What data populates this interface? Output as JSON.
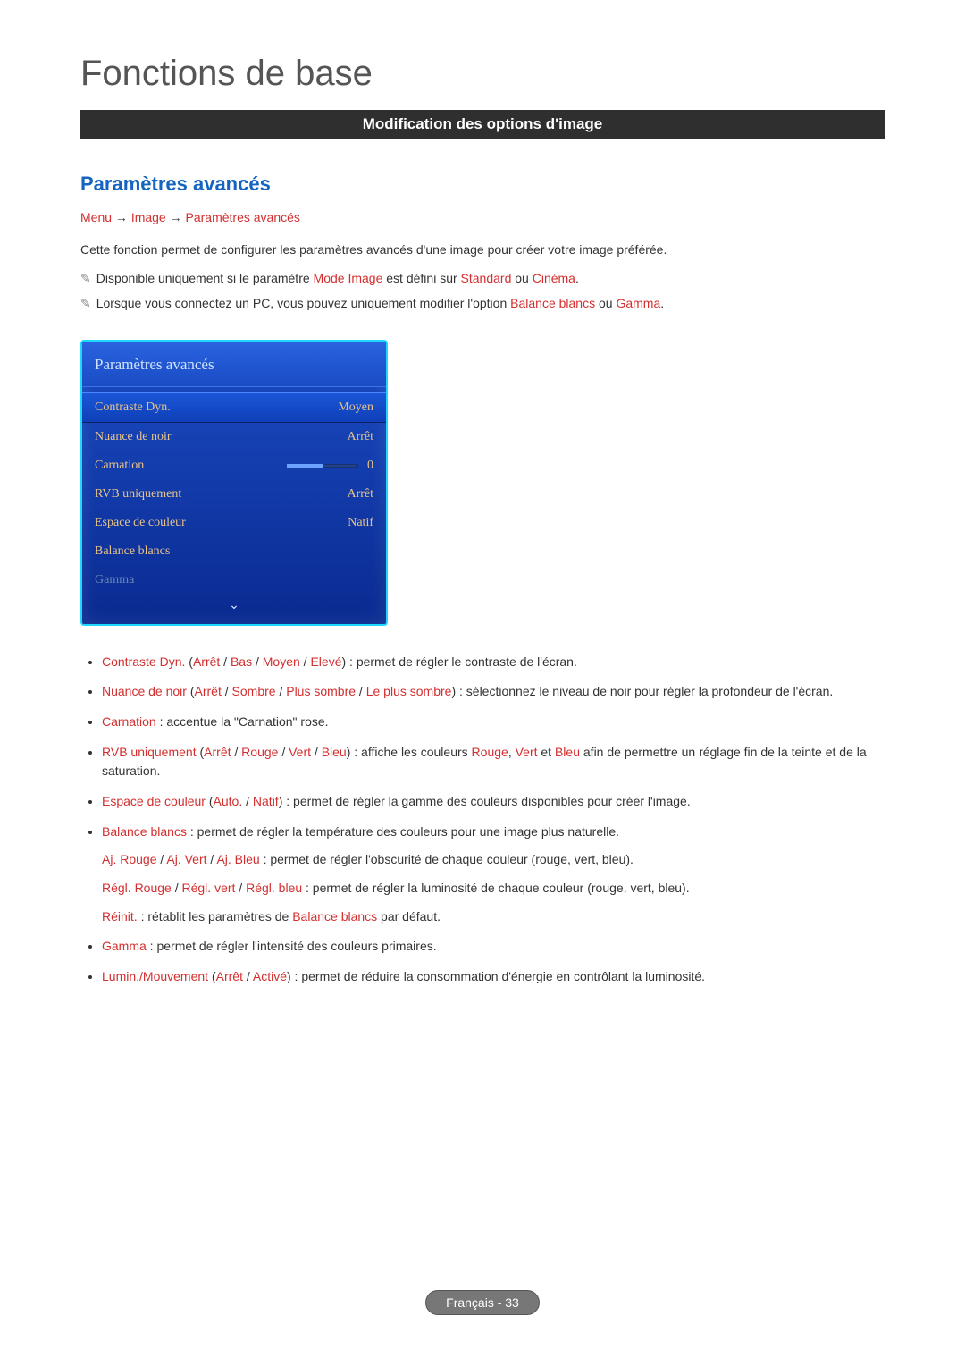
{
  "header": {
    "page_title": "Fonctions de base",
    "section_bar": "Modification des options d'image"
  },
  "section": {
    "title": "Paramètres avancés",
    "breadcrumb": {
      "a": "Menu",
      "b": "Image",
      "c": "Paramètres avancés",
      "arrow": "→"
    },
    "intro": "Cette fonction permet de configurer les paramètres avancés d'une image pour créer votre image préférée.",
    "note1": {
      "pre": "Disponible uniquement si le paramètre ",
      "k1": "Mode Image",
      "mid": " est défini sur ",
      "k2": "Standard",
      "or": " ou ",
      "k3": "Cinéma",
      "end": "."
    },
    "note2": {
      "pre": "Lorsque vous connectez un PC, vous pouvez uniquement modifier l'option ",
      "k1": "Balance blancs",
      "or": " ou ",
      "k2": "Gamma",
      "end": "."
    }
  },
  "panel": {
    "title": "Paramètres avancés",
    "rows": {
      "contraste": {
        "label": "Contraste Dyn.",
        "value": "Moyen"
      },
      "nuance": {
        "label": "Nuance de noir",
        "value": "Arrêt"
      },
      "carnation": {
        "label": "Carnation",
        "value": "0"
      },
      "rvb": {
        "label": "RVB uniquement",
        "value": "Arrêt"
      },
      "espace": {
        "label": "Espace de couleur",
        "value": "Natif"
      },
      "balance": {
        "label": "Balance blancs",
        "value": ""
      },
      "gamma": {
        "label": "Gamma",
        "value": ""
      }
    },
    "more_icon": "⌄"
  },
  "bullets": {
    "b1": {
      "k1": "Contraste Dyn.",
      "open": " (",
      "o1": "Arrêt",
      "sep": " / ",
      "o2": "Bas",
      "o3": "Moyen",
      "o4": "Elevé",
      "close": ")",
      "text": " : permet de régler le contraste de l'écran."
    },
    "b2": {
      "k1": "Nuance de noir",
      "open": " (",
      "o1": "Arrêt",
      "sep": " / ",
      "o2": "Sombre",
      "o3": "Plus sombre",
      "o4": "Le plus sombre",
      "close": ")",
      "text": " : sélectionnez le niveau de noir pour régler la profondeur de l'écran."
    },
    "b3": {
      "k1": "Carnation",
      "text": " : accentue la \"Carnation\" rose."
    },
    "b4": {
      "k1": "RVB uniquement",
      "open": " (",
      "o1": "Arrêt",
      "sep": " / ",
      "o2": "Rouge",
      "o3": "Vert",
      "o4": "Bleu",
      "close": ")",
      "text_a": " : affiche les couleurs ",
      "c1": "Rouge",
      "comma": ", ",
      "c2": "Vert",
      "and": " et ",
      "c3": "Bleu",
      "text_b": " afin de permettre un réglage fin de la teinte et de la saturation."
    },
    "b5": {
      "k1": "Espace de couleur",
      "open": " (",
      "o1": "Auto.",
      "sep": " / ",
      "o2": "Natif",
      "close": ")",
      "text": " : permet de régler la gamme des couleurs disponibles pour créer l'image."
    },
    "b6": {
      "k1": "Balance blancs",
      "text": " : permet de régler la température des couleurs pour une image plus naturelle.",
      "sub1": {
        "a": "Aj. Rouge",
        "sep": " / ",
        "b": "Aj. Vert",
        "c": "Aj. Bleu",
        "txt": " : permet de régler l'obscurité de chaque couleur (rouge, vert, bleu)."
      },
      "sub2": {
        "a": "Régl. Rouge",
        "sep": " / ",
        "b": "Régl. vert",
        "c": "Régl. bleu",
        "txt": " : permet de régler la luminosité de chaque couleur (rouge, vert, bleu)."
      },
      "sub3": {
        "a": "Réinit.",
        "txt_a": " : rétablit les paramètres de ",
        "k": "Balance blancs",
        "txt_b": " par défaut."
      }
    },
    "b7": {
      "k1": "Gamma",
      "text": " : permet de régler l'intensité des couleurs primaires."
    },
    "b8": {
      "k1": "Lumin./Mouvement",
      "open": " (",
      "o1": "Arrêt",
      "sep": " / ",
      "o2": "Activé",
      "close": ")",
      "text": " : permet de réduire la consommation d'énergie en contrôlant la luminosité."
    }
  },
  "footer": {
    "text": "Français - 33"
  }
}
